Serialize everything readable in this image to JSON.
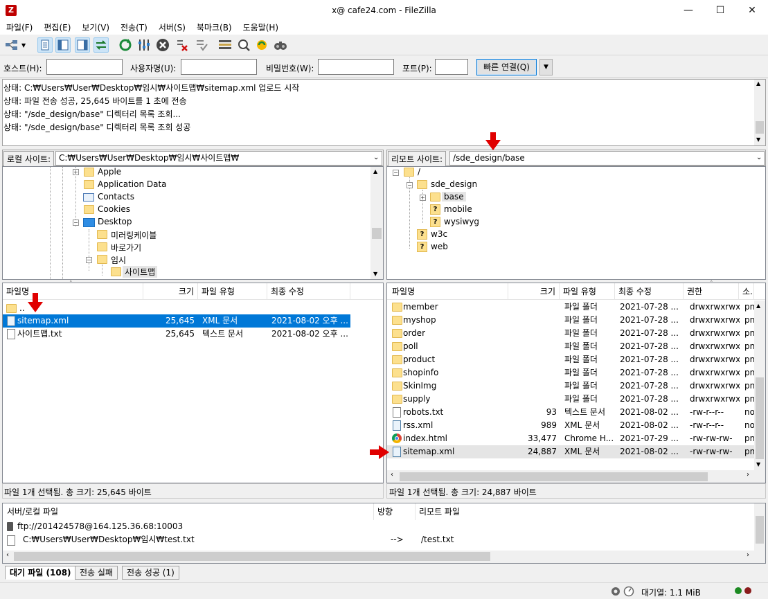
{
  "window": {
    "title": "x@           cafe24.com - FileZilla",
    "minimize": "—",
    "maximize": "☐",
    "close": "✕"
  },
  "menu": [
    "파일(F)",
    "편집(E)",
    "보기(V)",
    "전송(T)",
    "서버(S)",
    "북마크(B)",
    "도움말(H)"
  ],
  "quickconnect": {
    "host_label": "호스트(H):",
    "user_label": "사용자명(U):",
    "pass_label": "비밀번호(W):",
    "port_label": "포트(P):",
    "button": "빠른 연결(Q)",
    "dropdown": "▼"
  },
  "log": [
    "상태:   C:₩Users₩User₩Desktop₩임시₩사이트맵₩sitemap.xml 업로드 시작",
    "상태:   파일 전송 성공, 25,645 바이트를 1 초에 전송",
    "상태:   \"/sde_design/base\" 디렉터리 목록 조회...",
    "상태:   \"/sde_design/base\" 디렉터리 목록 조회 성공"
  ],
  "local": {
    "label": "로컬 사이트:",
    "path": "C:₩Users₩User₩Desktop₩임시₩사이트맵₩",
    "tree": [
      "Apple",
      "Application Data",
      "Contacts",
      "Cookies",
      "Desktop",
      "미러링케이블",
      "바로가기",
      "임시",
      "사이트맵"
    ],
    "columns": [
      "파일명",
      "크기",
      "파일 유형",
      "최종 수정"
    ],
    "files": [
      {
        "name": "..",
        "size": "",
        "type": "",
        "modified": ""
      },
      {
        "name": "sitemap.xml",
        "size": "25,645",
        "type": "XML 문서",
        "modified": "2021-08-02 오후 ..."
      },
      {
        "name": "사이트맵.txt",
        "size": "25,645",
        "type": "텍스트 문서",
        "modified": "2021-08-02 오후 ..."
      }
    ],
    "status": "파일 1개 선택됨. 총 크기: 25,645 바이트"
  },
  "remote": {
    "label": "리모트 사이트:",
    "path": "/sde_design/base",
    "tree": [
      "/",
      "sde_design",
      "base",
      "mobile",
      "wysiwyg",
      "w3c",
      "web"
    ],
    "columns": [
      "파일명",
      "크기",
      "파일 유형",
      "최종 수정",
      "권한",
      "소..."
    ],
    "files": [
      {
        "name": "member",
        "size": "",
        "type": "파일 폴더",
        "modified": "2021-07-28 ...",
        "perm": "drwxrwxrwx",
        "owner": "pn"
      },
      {
        "name": "myshop",
        "size": "",
        "type": "파일 폴더",
        "modified": "2021-07-28 ...",
        "perm": "drwxrwxrwx",
        "owner": "pn"
      },
      {
        "name": "order",
        "size": "",
        "type": "파일 폴더",
        "modified": "2021-07-28 ...",
        "perm": "drwxrwxrwx",
        "owner": "pn"
      },
      {
        "name": "poll",
        "size": "",
        "type": "파일 폴더",
        "modified": "2021-07-28 ...",
        "perm": "drwxrwxrwx",
        "owner": "pn"
      },
      {
        "name": "product",
        "size": "",
        "type": "파일 폴더",
        "modified": "2021-07-28 ...",
        "perm": "drwxrwxrwx",
        "owner": "pn"
      },
      {
        "name": "shopinfo",
        "size": "",
        "type": "파일 폴더",
        "modified": "2021-07-28 ...",
        "perm": "drwxrwxrwx",
        "owner": "pn"
      },
      {
        "name": "SkinImg",
        "size": "",
        "type": "파일 폴더",
        "modified": "2021-07-28 ...",
        "perm": "drwxrwxrwx",
        "owner": "pn"
      },
      {
        "name": "supply",
        "size": "",
        "type": "파일 폴더",
        "modified": "2021-07-28 ...",
        "perm": "drwxrwxrwx",
        "owner": "pn"
      },
      {
        "name": "robots.txt",
        "size": "93",
        "type": "텍스트 문서",
        "modified": "2021-08-02 ...",
        "perm": "-rw-r--r--",
        "owner": "no"
      },
      {
        "name": "rss.xml",
        "size": "989",
        "type": "XML 문서",
        "modified": "2021-08-02 ...",
        "perm": "-rw-r--r--",
        "owner": "no"
      },
      {
        "name": "index.html",
        "size": "33,477",
        "type": "Chrome H...",
        "modified": "2021-07-29 ...",
        "perm": "-rw-rw-rw-",
        "owner": "pn"
      },
      {
        "name": "sitemap.xml",
        "size": "24,887",
        "type": "XML 문서",
        "modified": "2021-08-02 ...",
        "perm": "-rw-rw-rw-",
        "owner": "pn"
      }
    ],
    "status": "파일 1개 선택됨. 총 크기: 24,887 바이트"
  },
  "queue": {
    "columns": [
      "서버/로컬 파일",
      "방향",
      "리모트 파일"
    ],
    "server": "ftp://201424578@164.125.36.68:10003",
    "local_file": "C:₩Users₩User₩Desktop₩임시₩test.txt",
    "direction": "-->",
    "remote_file": "/test.txt",
    "tabs": [
      "대기 파일 (108)",
      "전송 실패",
      "전송 성공 (1)"
    ]
  },
  "statusbar": {
    "queue": "대기열: 1.1 MiB"
  },
  "colors": {
    "selection": "#0078d7",
    "highlight_row": "#e5e5e5",
    "arrow": "#e00000"
  }
}
